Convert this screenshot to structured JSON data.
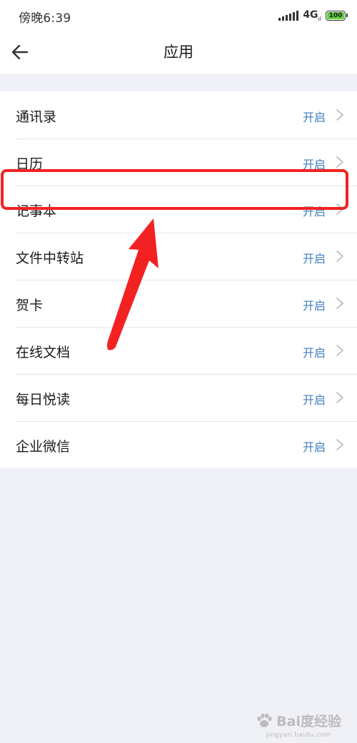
{
  "status_bar": {
    "time": "傍晚6:39",
    "network": "4G",
    "network_sub": "ıl",
    "battery": "100"
  },
  "header": {
    "title": "应用"
  },
  "icons": {
    "back": "arrow-left-icon",
    "chevron": "chevron-right-icon",
    "signal": "signal-icon",
    "battery": "battery-icon",
    "watermark": "baidu-paw-icon"
  },
  "apps": [
    {
      "label": "通讯录",
      "status": "开启"
    },
    {
      "label": "日历",
      "status": "开启"
    },
    {
      "label": "记事本",
      "status": "开启"
    },
    {
      "label": "文件中转站",
      "status": "开启"
    },
    {
      "label": "贺卡",
      "status": "开启"
    },
    {
      "label": "在线文档",
      "status": "开启"
    },
    {
      "label": "每日悦读",
      "status": "开启"
    },
    {
      "label": "企业微信",
      "status": "开启"
    }
  ],
  "annotation": {
    "highlighted_item": "记事本",
    "color": "#f22222"
  },
  "watermark": {
    "text": "Bai度经验",
    "sub": "jingyan.baidu.com"
  },
  "colors": {
    "accent": "#3f7fbf",
    "background": "#f0f1f6"
  }
}
